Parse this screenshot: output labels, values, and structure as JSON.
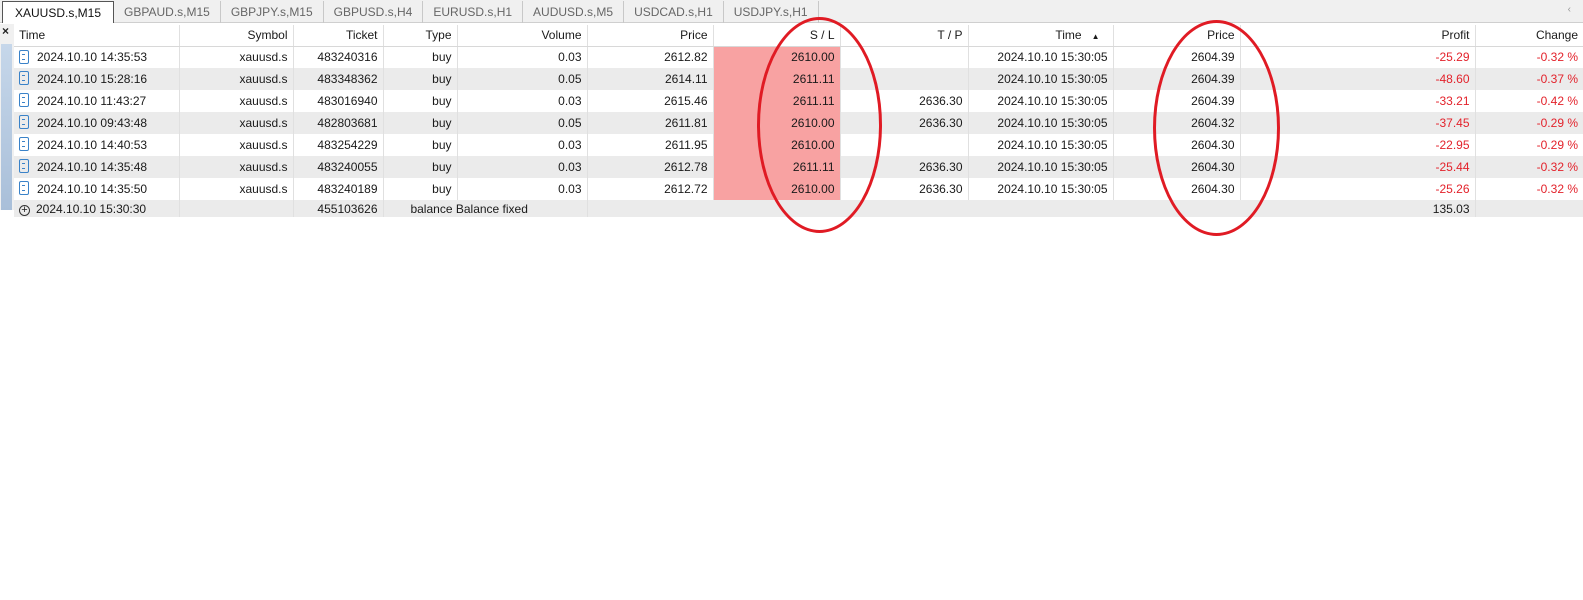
{
  "tabs": [
    "XAUUSD.s,M15",
    "GBPAUD.s,M15",
    "GBPJPY.s,M15",
    "GBPUSD.s,H4",
    "EURUSD.s,H1",
    "AUDUSD.s,M5",
    "USDCAD.s,H1",
    "USDJPY.s,H1"
  ],
  "headers": {
    "time": "Time",
    "symbol": "Symbol",
    "ticket": "Ticket",
    "type": "Type",
    "volume": "Volume",
    "price": "Price",
    "sl": "S / L",
    "tp": "T / P",
    "time2": "Time",
    "sort": "▲",
    "price2": "Price",
    "profit": "Profit",
    "change": "Change"
  },
  "rows": [
    {
      "time": "2024.10.10 14:35:53",
      "symbol": "xauusd.s",
      "ticket": "483240316",
      "type": "buy",
      "volume": "0.03",
      "price": "2612.82",
      "sl": "2610.00",
      "tp": "",
      "time2": "2024.10.10 15:30:05",
      "price2": "2604.39",
      "profit": "-25.29",
      "change": "-0.32 %"
    },
    {
      "time": "2024.10.10 15:28:16",
      "symbol": "xauusd.s",
      "ticket": "483348362",
      "type": "buy",
      "volume": "0.05",
      "price": "2614.11",
      "sl": "2611.11",
      "tp": "",
      "time2": "2024.10.10 15:30:05",
      "price2": "2604.39",
      "profit": "-48.60",
      "change": "-0.37 %"
    },
    {
      "time": "2024.10.10 11:43:27",
      "symbol": "xauusd.s",
      "ticket": "483016940",
      "type": "buy",
      "volume": "0.03",
      "price": "2615.46",
      "sl": "2611.11",
      "tp": "2636.30",
      "time2": "2024.10.10 15:30:05",
      "price2": "2604.39",
      "profit": "-33.21",
      "change": "-0.42 %"
    },
    {
      "time": "2024.10.10 09:43:48",
      "symbol": "xauusd.s",
      "ticket": "482803681",
      "type": "buy",
      "volume": "0.05",
      "price": "2611.81",
      "sl": "2610.00",
      "tp": "2636.30",
      "time2": "2024.10.10 15:30:05",
      "price2": "2604.32",
      "profit": "-37.45",
      "change": "-0.29 %"
    },
    {
      "time": "2024.10.10 14:40:53",
      "symbol": "xauusd.s",
      "ticket": "483254229",
      "type": "buy",
      "volume": "0.03",
      "price": "2611.95",
      "sl": "2610.00",
      "tp": "",
      "time2": "2024.10.10 15:30:05",
      "price2": "2604.30",
      "profit": "-22.95",
      "change": "-0.29 %"
    },
    {
      "time": "2024.10.10 14:35:48",
      "symbol": "xauusd.s",
      "ticket": "483240055",
      "type": "buy",
      "volume": "0.03",
      "price": "2612.78",
      "sl": "2611.11",
      "tp": "2636.30",
      "time2": "2024.10.10 15:30:05",
      "price2": "2604.30",
      "profit": "-25.44",
      "change": "-0.32 %"
    },
    {
      "time": "2024.10.10 14:35:50",
      "symbol": "xauusd.s",
      "ticket": "483240189",
      "type": "buy",
      "volume": "0.03",
      "price": "2612.72",
      "sl": "2610.00",
      "tp": "2636.30",
      "time2": "2024.10.10 15:30:05",
      "price2": "2604.30",
      "profit": "-25.26",
      "change": "-0.32 %"
    }
  ],
  "balance": {
    "time": "2024.10.10 15:30:30",
    "ticket": "455103626",
    "type": "balance",
    "comment": "Balance fixed",
    "profit": "135.03"
  },
  "colors": {
    "sl_highlight": "#f8a2a2",
    "negative": "#e3222b",
    "annotation": "#e01b24"
  }
}
